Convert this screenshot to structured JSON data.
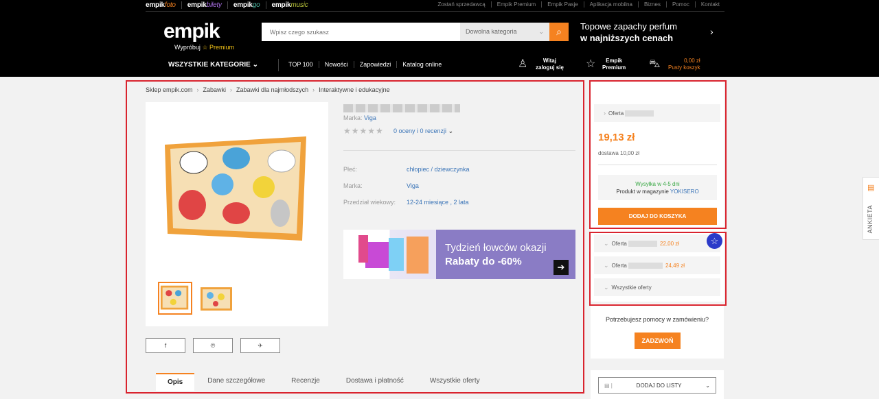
{
  "services": [
    {
      "brand": "empik",
      "suffix": "foto"
    },
    {
      "brand": "empik",
      "suffix": "bilety"
    },
    {
      "brand": "empik",
      "suffix": "go"
    },
    {
      "brand": "empik",
      "suffix": "music"
    }
  ],
  "top_links": [
    "Zostań sprzedawcą",
    "Empik Premium",
    "Empik Pasje",
    "Aplikacja mobilna",
    "Biznes",
    "Pomoc",
    "Kontakt"
  ],
  "header": {
    "logo": "empik",
    "try": "Wypróbuj",
    "premium": "Premium",
    "search_placeholder": "Wpisz czego szukasz",
    "category": "Dowolna kategoria",
    "promo_line1": "Topowe zapachy perfum",
    "promo_line2": "w najniższych cenach"
  },
  "nav": {
    "all_categories": "WSZYSTKIE KATEGORIE",
    "links": [
      "TOP 100",
      "Nowości",
      "Zapowiedzi",
      "Katalog online"
    ],
    "user_l1": "Witaj",
    "user_l2": "zaloguj się",
    "premium_l1": "Empik",
    "premium_l2": "Premium",
    "cart_price": "0,00 zł",
    "cart_label": "Pusty koszyk"
  },
  "breadcrumbs": [
    "Sklep empik.com",
    "Zabawki",
    "Zabawki dla najmłodszych",
    "Interaktywne i edukacyjne"
  ],
  "product": {
    "brand_label": "Marka:",
    "brand": "Viga",
    "reviews": "0 oceny i 0 recenzji",
    "attributes": [
      {
        "label": "Płeć:",
        "value": "chłopiec / dziewczynka"
      },
      {
        "label": "Marka:",
        "value": "Viga"
      },
      {
        "label": "Przedział wiekowy:",
        "value": "12-24 miesiące , 2 lata"
      }
    ]
  },
  "banner": {
    "line1": "Tydzień łowców okazji",
    "line2": "Rabaty do -60%"
  },
  "tabs": [
    "Opis",
    "Dane szczegółowe",
    "Recenzje",
    "Dostawa i płatność",
    "Wszystkie oferty"
  ],
  "offer": {
    "label": "Oferta",
    "price": "19,13 zł",
    "delivery": "dostawa 10,00 zł",
    "shipping": "Wysyłka w 4-5 dni",
    "stock_prefix": "Produkt w magazynie",
    "seller": "YOKISERO",
    "add_to_cart": "DODAJ DO KOSZYKA"
  },
  "other_offers": [
    {
      "label": "Oferta",
      "price": "22,00 zł"
    },
    {
      "label": "Oferta",
      "price": "24,49 zł"
    }
  ],
  "all_offers": "Wszystkie oferty",
  "help": {
    "text": "Potrzebujesz pomocy w zamówieniu?",
    "button": "ZADZWOŃ"
  },
  "list": {
    "button": "DODAJ DO LISTY"
  },
  "survey": "ANKIETA",
  "colors": {
    "accent": "#f58220",
    "link": "#3a74b7",
    "highlight": "#d9232e",
    "shipping": "#3aa845"
  }
}
